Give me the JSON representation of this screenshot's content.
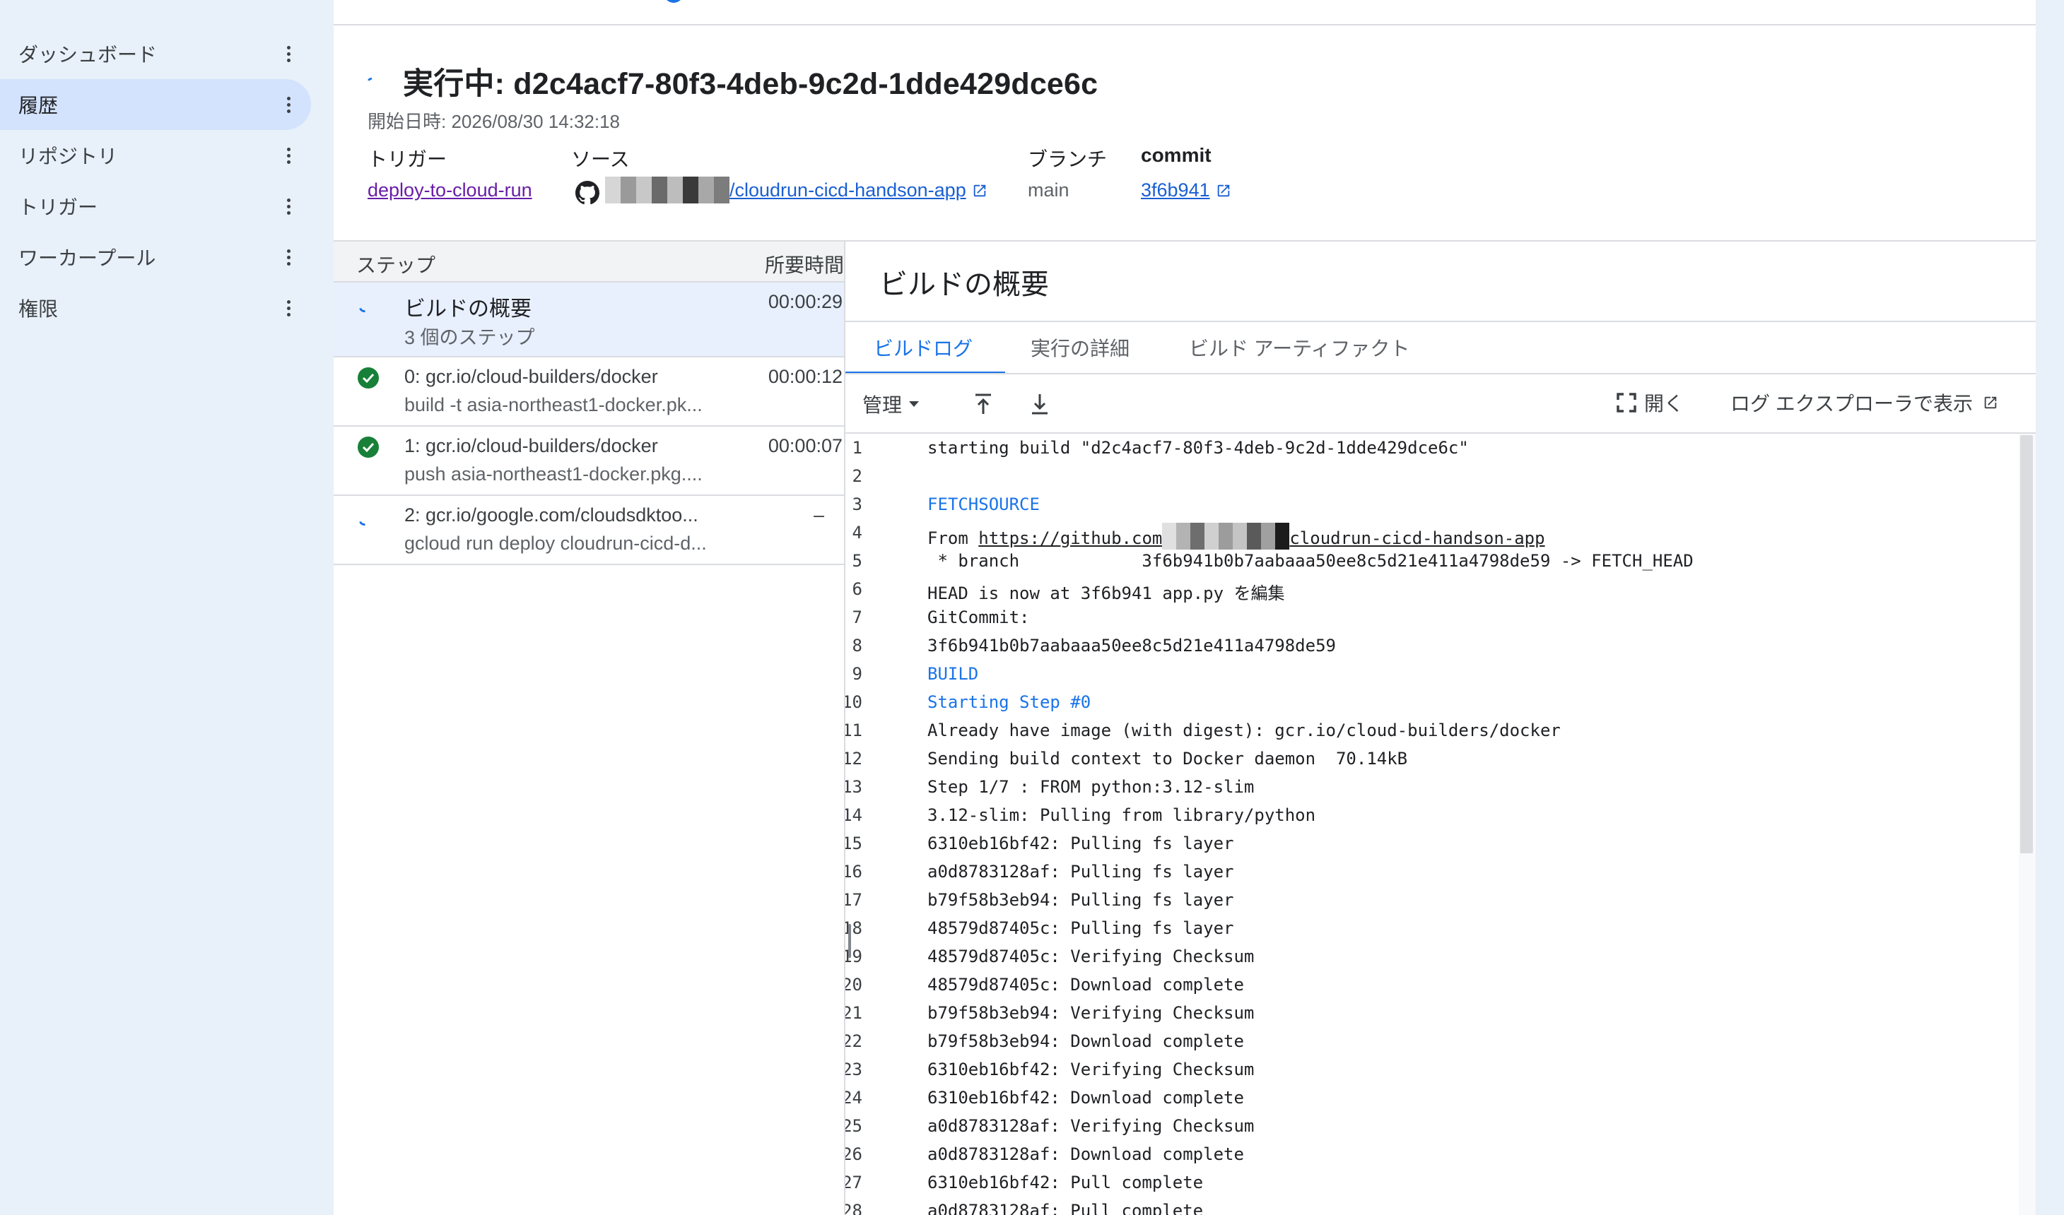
{
  "sidebar": {
    "items": [
      {
        "label": "ダッシュボード"
      },
      {
        "label": "履歴",
        "active": true
      },
      {
        "label": "リポジトリ"
      },
      {
        "label": "トリガー"
      },
      {
        "label": "ワーカープール"
      },
      {
        "label": "権限"
      }
    ]
  },
  "build": {
    "title": "実行中: d2c4acf7-80f3-4deb-9c2d-1dde429dce6c",
    "started": "開始日時: 2026/08/30 14:32:18",
    "trigger_label": "トリガー",
    "trigger_value": "deploy-to-cloud-run",
    "source_label": "ソース",
    "source_value": "/cloudrun-cicd-handson-app",
    "branch_label": "ブランチ",
    "branch_value": "main",
    "commit_label": "commit",
    "commit_value": "3f6b941"
  },
  "steps": {
    "header_step": "ステップ",
    "header_duration": "所要時間",
    "items": [
      {
        "line1": "ビルドの概要",
        "line2": "3 個のステップ",
        "duration": "00:00:29",
        "status": "running"
      },
      {
        "line1": "0: gcr.io/cloud-builders/docker",
        "line2": "build -t asia-northeast1-docker.pk...",
        "duration": "00:00:12",
        "status": "success"
      },
      {
        "line1": "1: gcr.io/cloud-builders/docker",
        "line2": "push asia-northeast1-docker.pkg....",
        "duration": "00:00:07",
        "status": "success"
      },
      {
        "line1": "2: gcr.io/google.com/cloudsdktoo...",
        "line2": "gcloud run deploy cloudrun-cicd-d...",
        "duration": "–",
        "status": "running"
      }
    ]
  },
  "log_panel": {
    "title": "ビルドの概要",
    "tabs": [
      "ビルドログ",
      "実行の詳細",
      "ビルド アーティファクト"
    ],
    "manage_label": "管理",
    "expand_label": "開く",
    "explorer_label": "ログ エクスプローラで表示",
    "url_prefix": "https://github.com",
    "url_suffix": "cloudrun-cicd-handson-app",
    "lines": [
      {
        "n": "1",
        "text": "starting build \"d2c4acf7-80f3-4deb-9c2d-1dde429dce6c\""
      },
      {
        "n": "2",
        "text": ""
      },
      {
        "n": "3",
        "text": "FETCHSOURCE",
        "blue": true
      },
      {
        "n": "4",
        "text": "From ",
        "url": true
      },
      {
        "n": "5",
        "text": " * branch            3f6b941b0b7aabaaa50ee8c5d21e411a4798de59 -> FETCH_HEAD"
      },
      {
        "n": "6",
        "text": "HEAD is now at 3f6b941 app.py を編集"
      },
      {
        "n": "7",
        "text": "GitCommit:"
      },
      {
        "n": "8",
        "text": "3f6b941b0b7aabaaa50ee8c5d21e411a4798de59"
      },
      {
        "n": "9",
        "text": "BUILD",
        "blue": true
      },
      {
        "n": "10",
        "text": "Starting Step #0",
        "blue": true
      },
      {
        "n": "11",
        "text": "Already have image (with digest): gcr.io/cloud-builders/docker"
      },
      {
        "n": "12",
        "text": "Sending build context to Docker daemon  70.14kB"
      },
      {
        "n": "13",
        "text": "Step 1/7 : FROM python:3.12-slim"
      },
      {
        "n": "14",
        "text": "3.12-slim: Pulling from library/python"
      },
      {
        "n": "15",
        "text": "6310eb16bf42: Pulling fs layer"
      },
      {
        "n": "16",
        "text": "a0d8783128af: Pulling fs layer"
      },
      {
        "n": "17",
        "text": "b79f58b3eb94: Pulling fs layer"
      },
      {
        "n": "18",
        "text": "48579d87405c: Pulling fs layer"
      },
      {
        "n": "19",
        "text": "48579d87405c: Verifying Checksum"
      },
      {
        "n": "20",
        "text": "48579d87405c: Download complete"
      },
      {
        "n": "21",
        "text": "b79f58b3eb94: Verifying Checksum"
      },
      {
        "n": "22",
        "text": "b79f58b3eb94: Download complete"
      },
      {
        "n": "23",
        "text": "6310eb16bf42: Verifying Checksum"
      },
      {
        "n": "24",
        "text": "6310eb16bf42: Download complete"
      },
      {
        "n": "25",
        "text": "a0d8783128af: Verifying Checksum"
      },
      {
        "n": "26",
        "text": "a0d8783128af: Download complete"
      },
      {
        "n": "27",
        "text": "6310eb16bf42: Pull complete"
      },
      {
        "n": "28",
        "text": "a0d8783128af: Pull complete"
      }
    ]
  },
  "colors": {
    "accent": "#1a73e8",
    "success": "#188038",
    "sidebar_bg": "#e8f0f9",
    "visited_link": "#681da8"
  }
}
